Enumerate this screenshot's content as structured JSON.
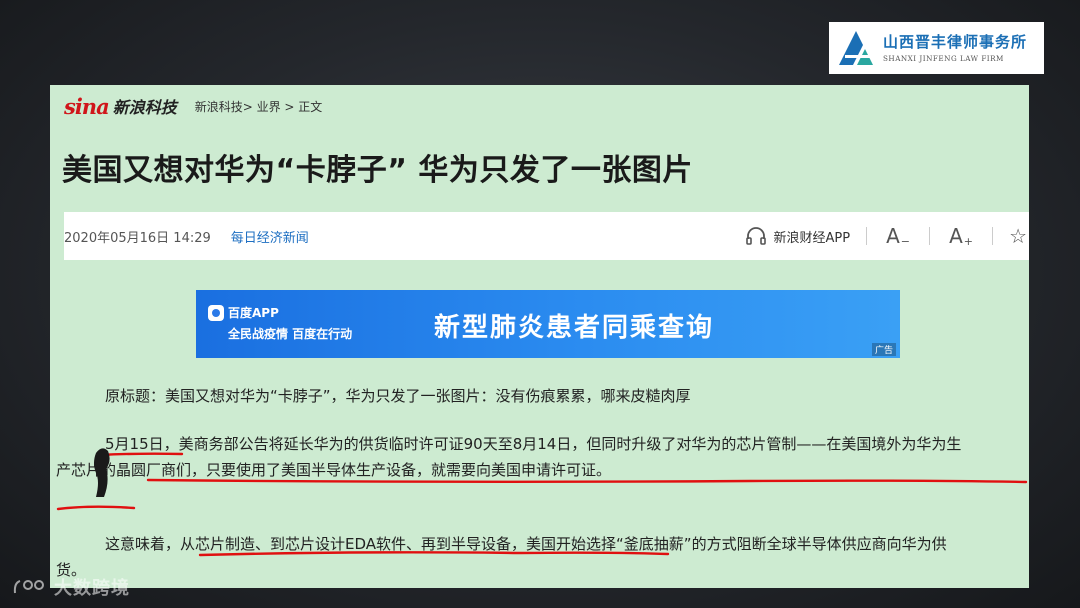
{
  "logo": {
    "name_cn": "山西晋丰律师事务所",
    "name_en": "SHANXI JINFENG LAW FIRM",
    "color": "#1b6fb5"
  },
  "site": {
    "logo_text": "sina",
    "name": "新浪科技",
    "breadcrumb": "新浪科技> 业界 > 正文"
  },
  "article": {
    "title": "美国又想对华为“卡脖子” 华为只发了一张图片",
    "date": "2020年05月16日 14:29",
    "source": "每日经济新闻",
    "app_label": "新浪财经APP",
    "font_decrease": "A",
    "font_increase": "A",
    "paragraphs": [
      "原标题：美国又想对华为“卡脖子”，华为只发了一张图片：没有伤痕累累，哪来皮糙肉厚",
      "5月15日，美商务部公告将延长华为的供货临时许可证90天至8月14日，但同时升级了对华为的芯片管制——在美国境外为华为生产芯片的晶圆厂商们，只要使用了美国半导体生产设备，就需要向美国申请许可证。",
      "这意味着，从芯片制造、到芯片设计EDA软件、再到半导设备，美国开始选择“釜底抽薪”的方式阻断全球半导体供应商向华为供货。"
    ]
  },
  "banner": {
    "brand": "百度APP",
    "tagline": "全民战疫情 百度在行动",
    "headline": "新型肺炎患者同乘查询",
    "ad_label": "广告"
  },
  "watermark": {
    "text": "大数跨境"
  },
  "colors": {
    "panel_bg": "#cdebd1",
    "underline": "#e01010",
    "link": "#1e6fc2",
    "sina_red": "#d0151a"
  }
}
